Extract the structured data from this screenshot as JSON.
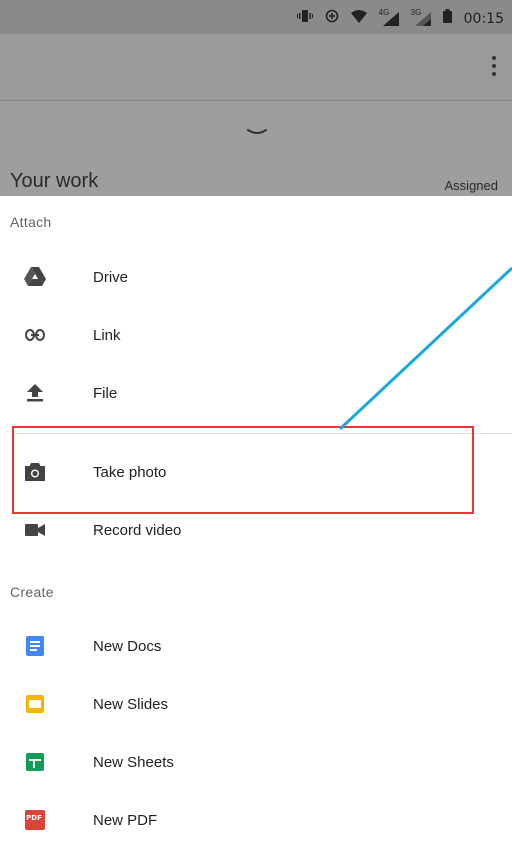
{
  "status_bar": {
    "time": "00:15",
    "net_4g": "4G",
    "net_3g": "3G"
  },
  "header": {
    "title": "Your work",
    "status": "Assigned"
  },
  "sheet": {
    "attach_header": "Attach",
    "attach_items": [
      {
        "label": "Drive",
        "icon": "drive-icon"
      },
      {
        "label": "Link",
        "icon": "link-icon"
      },
      {
        "label": "File",
        "icon": "upload-icon"
      },
      {
        "label": "Take photo",
        "icon": "camera-icon"
      },
      {
        "label": "Record video",
        "icon": "video-camera-icon"
      }
    ],
    "create_header": "Create",
    "create_items": [
      {
        "label": "New Docs",
        "icon": "docs-icon",
        "color": "#4285F4"
      },
      {
        "label": "New Slides",
        "icon": "slides-icon",
        "color": "#F4B400"
      },
      {
        "label": "New Sheets",
        "icon": "sheets-icon",
        "color": "#0F9D58"
      },
      {
        "label": "New PDF",
        "icon": "pdf-icon",
        "color": "#DB4437",
        "badge": "PDF"
      }
    ]
  },
  "annotation": {
    "box_color": "#e53935",
    "line_color": "#1aa7e0"
  }
}
